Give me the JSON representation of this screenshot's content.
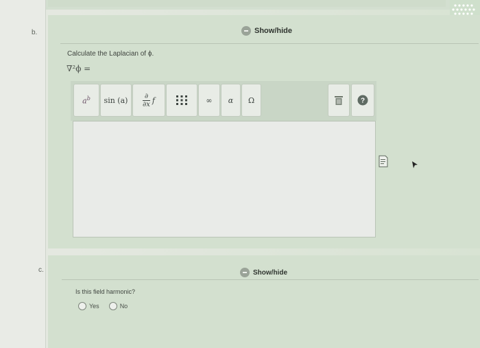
{
  "part_b": {
    "letter": "b.",
    "show_hide": "Show/hide",
    "prompt": "Calculate the Laplacian of ϕ.",
    "equation_label": "∇²ϕ =",
    "toolbar": {
      "power_label": "a",
      "power_sup": "b",
      "sin_label": "sin (a)",
      "partial_top": "∂",
      "partial_bottom": "∂x",
      "partial_f": "f",
      "infinity_label": "∞",
      "alpha_label": "α",
      "omega_label": "Ω"
    }
  },
  "part_c": {
    "letter": "c.",
    "show_hide": "Show/hide",
    "question": "Is this field harmonic?",
    "options": [
      {
        "label": "Yes"
      },
      {
        "label": "No"
      }
    ]
  },
  "colors": {
    "section_bg": "#d3e0cf",
    "toolbar_bg": "#c9d6c6",
    "help_button": "#5f6b63"
  }
}
